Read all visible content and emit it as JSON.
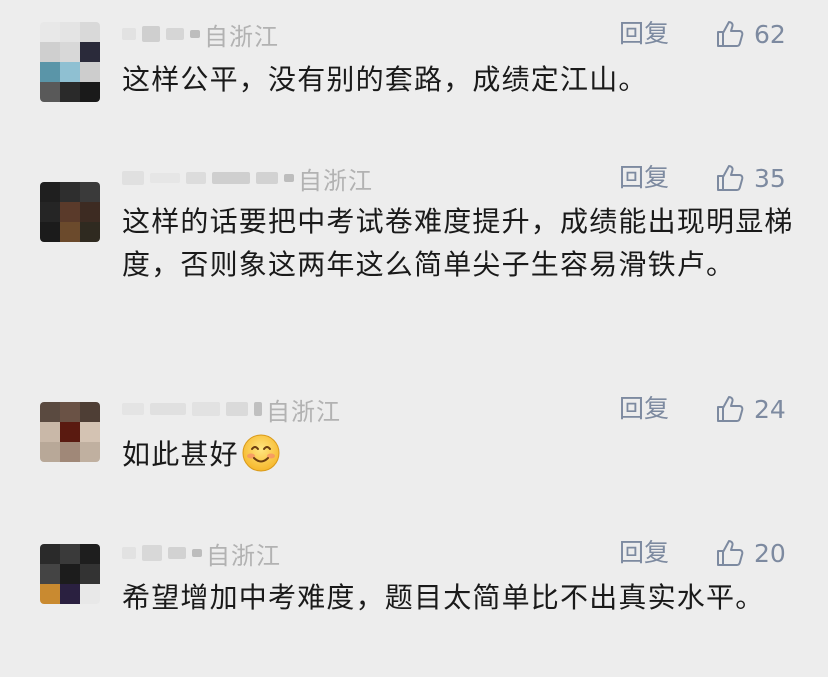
{
  "comments": [
    {
      "location": "自浙江",
      "reply_label": "回复",
      "likes": "62",
      "text": "这样公平，没有别的套路，成绩定江山。",
      "avatar_colors": [
        "#e8e8e8",
        "#e4e4e4",
        "#d9d9d9",
        "#cfcfcf",
        "#7aa8c4",
        "#d0d0d0",
        "#5a95a8",
        "#8fc0d2",
        "#cdcdcd",
        "#595959",
        "#2a2a2a",
        "#1a1a1a"
      ]
    },
    {
      "location": "自浙江",
      "reply_label": "回复",
      "likes": "35",
      "text": "这样的话要把中考试卷难度提升，成绩能出现明显梯度，否则象这两年这么简单尖子生容易滑铁卢。",
      "avatar_colors": [
        "#1f1f1f",
        "#2e2e2e",
        "#3a3a3a",
        "#252525",
        "#5a3a2a",
        "#3d2b22",
        "#1b1b1b",
        "#6b4a2c",
        "#2f2a20"
      ]
    },
    {
      "location": "自浙江",
      "reply_label": "回复",
      "likes": "24",
      "text": "如此甚好",
      "has_emoji": true,
      "emoji_name": "smile-emoji",
      "avatar_colors": [
        "#5a4a40",
        "#6a5245",
        "#4e3e35",
        "#c9b8a8",
        "#5a1a10",
        "#d4c3b3",
        "#b8a898",
        "#a08878",
        "#c0b0a0"
      ]
    },
    {
      "location": "自浙江",
      "reply_label": "回复",
      "likes": "20",
      "text": "希望增加中考难度，题目太简单比不出真实水平。",
      "avatar_colors": [
        "#2a2a2a",
        "#3a3a3a",
        "#1e1e1e",
        "#444444",
        "#1c1c1c",
        "#333333",
        "#c98a30",
        "#2a2040",
        "#e8e8e8"
      ]
    }
  ],
  "colors": {
    "background": "#ededed",
    "meta_text": "#b2b2b2",
    "action_text": "#7d8aa0",
    "body_text": "#1a1a1a"
  },
  "icons": {
    "like": "thumbs-up-icon"
  }
}
